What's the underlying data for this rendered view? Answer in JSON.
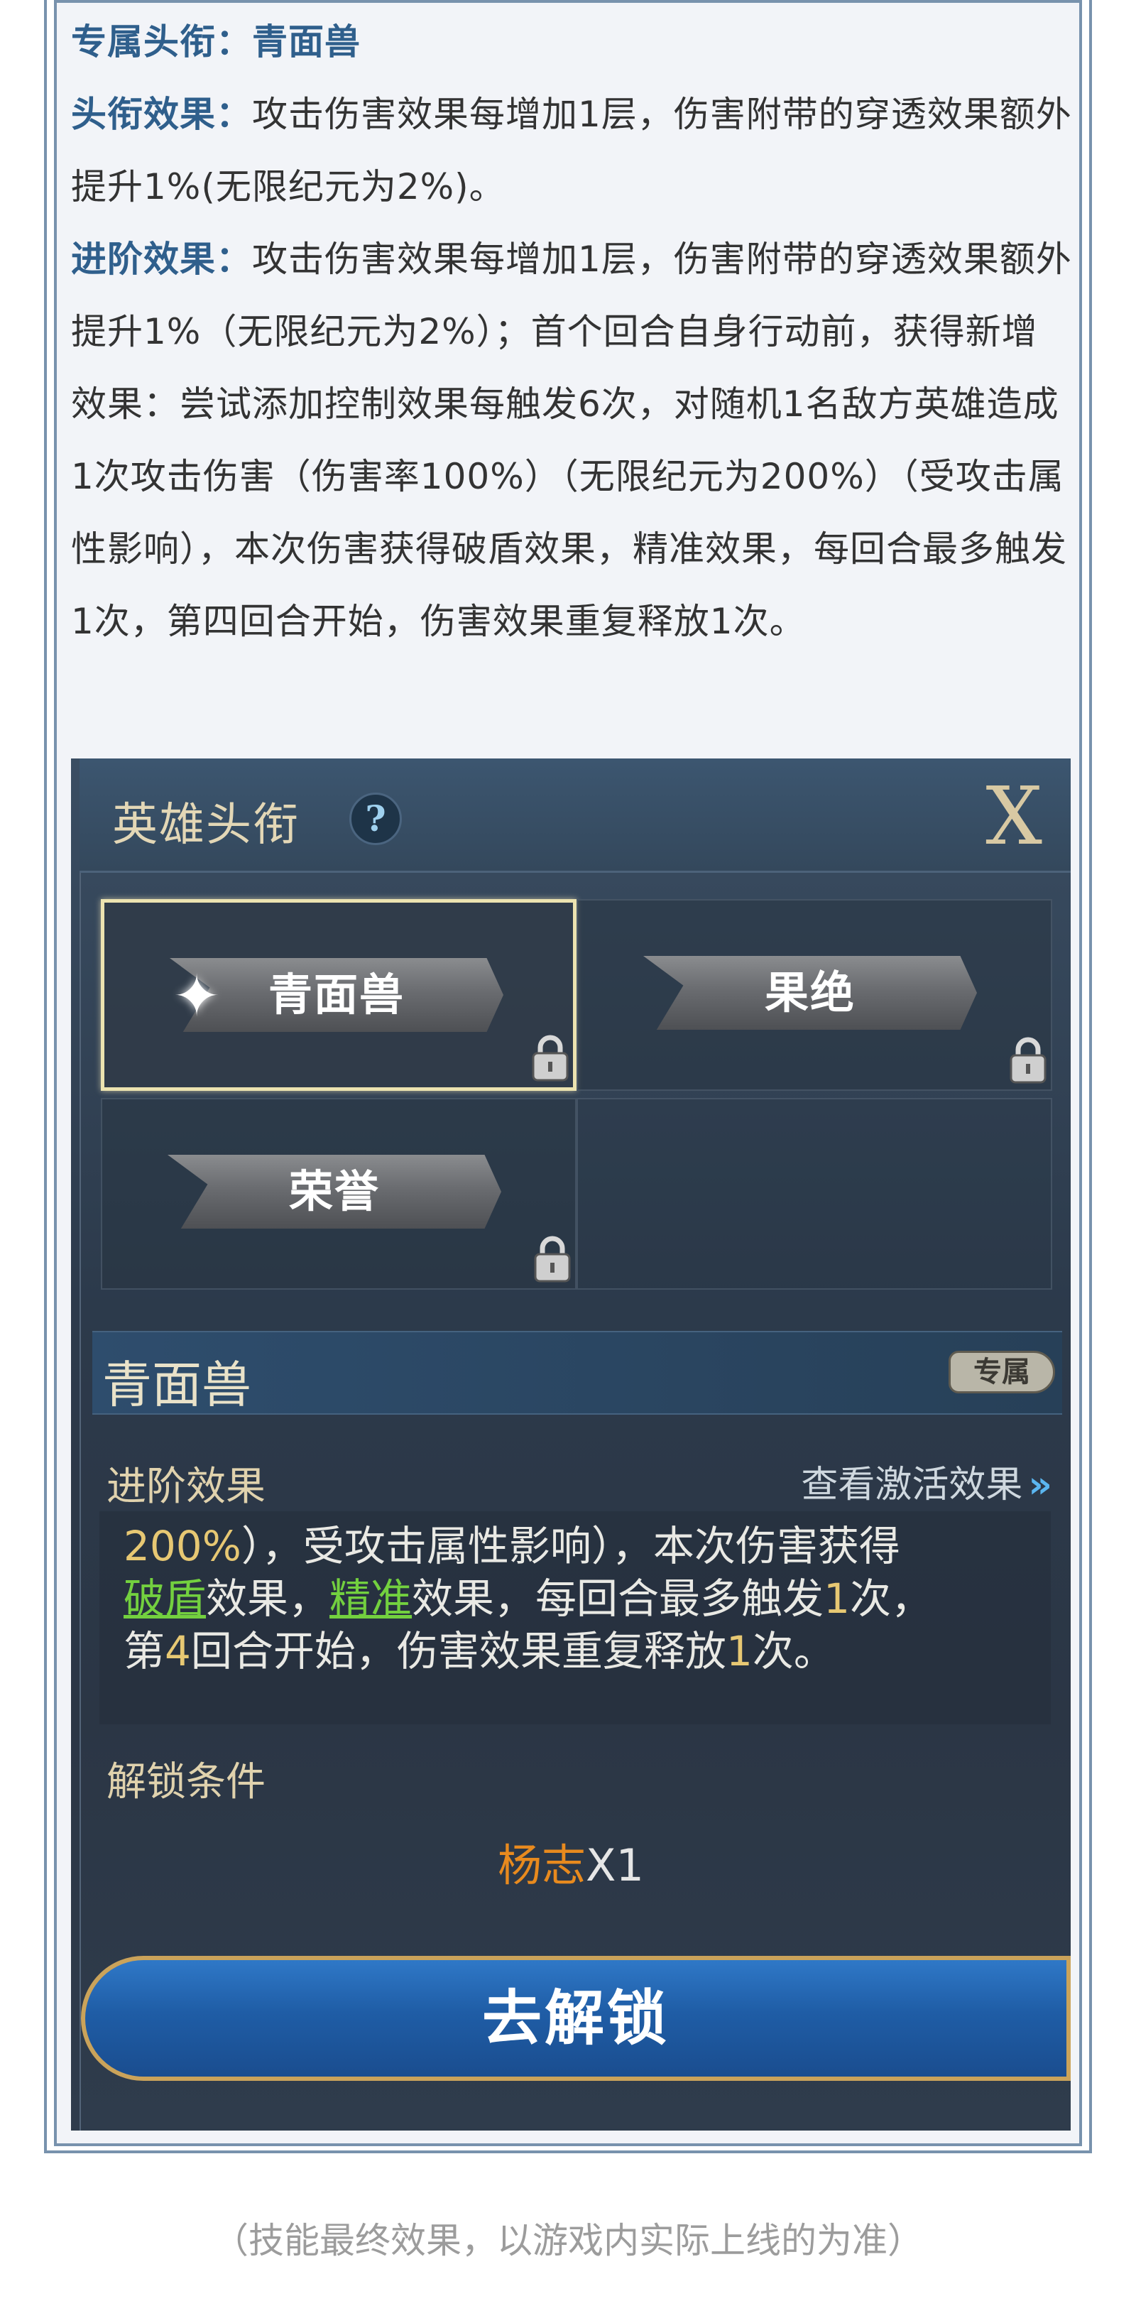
{
  "description": {
    "title_label": "专属头衔：",
    "title_value": "青面兽",
    "effect_label": "头衔效果：",
    "effect_text": "攻击伤害效果每增加1层，伤害附带的穿透效果额外提升1%(无限纪元为2%)。",
    "advanced_label": "进阶效果：",
    "advanced_text": "攻击伤害效果每增加1层，伤害附带的穿透效果额外提升1%（无限纪元为2%）；首个回合自身行动前，获得新增效果：尝试添加控制效果每触发6次，对随机1名敌方英雄造成1次攻击伤害（伤害率100%）（无限纪元为200%）（受攻击属性影响），本次伤害获得破盾效果，精准效果，每回合最多触发1次，第四回合开始，伤害效果重复释放1次。"
  },
  "game": {
    "window_title": "英雄头衔",
    "help_glyph": "?",
    "close_glyph": "X",
    "titles": [
      {
        "name": "青面兽",
        "selected": true,
        "locked": true
      },
      {
        "name": "果绝",
        "selected": false,
        "locked": true
      },
      {
        "name": "荣誉",
        "selected": false,
        "locked": true
      }
    ],
    "detail": {
      "name": "青面兽",
      "badge": "专属",
      "advanced_label": "进阶效果",
      "view_link": "查看激活效果",
      "view_link_icon": "»",
      "effect_lines": {
        "l1_a": "200%",
        "l1_b": "），受攻击属性影响），本次伤害获得",
        "l2_a": "破盾",
        "l2_b": "效果，",
        "l2_c": "精准",
        "l2_d": "效果，每回合最多触发",
        "l2_e": "1",
        "l2_f": "次，",
        "l3_a": "第",
        "l3_b": "4",
        "l3_c": "回合开始，伤害效果重复释放",
        "l3_d": "1",
        "l3_e": "次。"
      },
      "unlock_label": "解锁条件",
      "unlock_hero": "杨志",
      "unlock_count": "X1",
      "unlock_button": "去解锁"
    },
    "colors": {
      "gold": "#e7c873",
      "green": "#73d03f",
      "hero_orange": "#e88a1e",
      "button_blue": "#1f5da6"
    }
  },
  "caption": "（技能最终效果，以游戏内实际上线的为准）"
}
